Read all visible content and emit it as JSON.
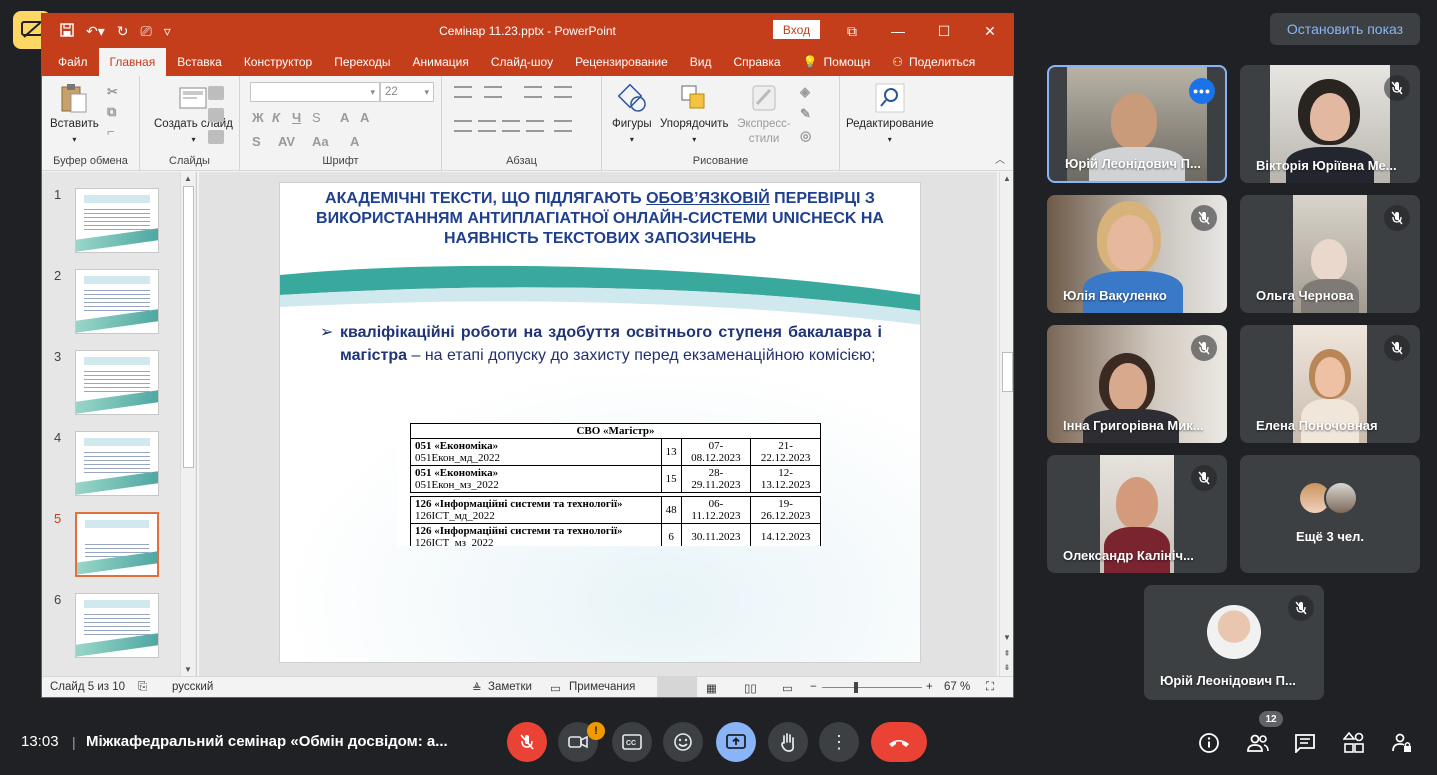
{
  "meet": {
    "stop_presenting_label": "Остановить показ",
    "time": "13:03",
    "meeting_title": "Міжкафедральний семінар «Обмін досвідом: а...",
    "participants_count": "12",
    "others_label": "Ещё 3 чел."
  },
  "ppt": {
    "title": "Семінар 11.23.pptx  -  PowerPoint",
    "login_label": "Вход",
    "tabs": [
      "Файл",
      "Главная",
      "Вставка",
      "Конструктор",
      "Переходы",
      "Анимация",
      "Слайд-шоу",
      "Рецензирование",
      "Вид",
      "Справка",
      "Помощн",
      "Поделиться"
    ],
    "ribbon": {
      "paste": "Вставить",
      "new_slide": "Создать слайд",
      "clipboard_group": "Буфер обмена",
      "slides_group": "Слайды",
      "font_group": "Шрифт",
      "paragraph_group": "Абзац",
      "drawing_group": "Рисование",
      "shapes": "Фигуры",
      "arrange": "Упорядочить",
      "quick_styles": "Экспресс-стили",
      "editing": "Редактирование",
      "font_size": "22"
    },
    "thumbnail_numbers": [
      "1",
      "2",
      "3",
      "4",
      "5",
      "6"
    ],
    "status": {
      "slide_of": "Слайд 5 из 10",
      "language": "русский",
      "notes": "Заметки",
      "comments": "Примечания",
      "zoom": "67 %"
    }
  },
  "slide": {
    "title_part1": "АКАДЕМІЧНІ ТЕКСТИ, ЩО ПІДЛЯГАЮТЬ ",
    "title_underlined": "ОБОВ’ЯЗКОВІЙ",
    "title_part2": " ПЕРЕВІРЦІ  З ВИКОРИСТАННЯМ АНТИПЛАГІАТНОЇ ОНЛАЙН-СИСТЕМИ UNICHECK НА НАЯВНІСТЬ ТЕКСТОВИХ ЗАПОЗИЧЕНЬ",
    "bullet_bold": "кваліфікаційні роботи на здобуття освітнього ступеня бакалавра і магістра",
    "bullet_rest": " –  на етапі допуску до захисту перед екзаменаційною комісією;",
    "table": {
      "header": "СВО «Магістр»",
      "rows": [
        {
          "program": "051 «Економіка»",
          "group": "051Екон_мд_2022",
          "count": "13",
          "dates1": "07-08.12.2023",
          "dates2": "21-22.12.2023"
        },
        {
          "program": "051 «Економіка»",
          "group": "051Екон_мз_2022",
          "count": "15",
          "dates1": "28-29.11.2023",
          "dates2": "12-13.12.2023"
        },
        {
          "program": "126 «Інформаційні системи та технології»",
          "group": "126ІСТ_мд_2022",
          "count": "48",
          "dates1": "06-11.12.2023",
          "dates2": "19-26.12.2023"
        },
        {
          "program": "126 «Інформаційні системи та технології»",
          "group": "126ІСТ_мз_2022",
          "count": "6",
          "dates1": "30.11.2023",
          "dates2": "14.12.2023"
        }
      ]
    }
  },
  "participants": [
    {
      "name": "Юрій Леонідович П..."
    },
    {
      "name": "Вікторія Юріївна Ме..."
    },
    {
      "name": "Юлія Вакуленко"
    },
    {
      "name": "Ольга Чернова"
    },
    {
      "name": "Інна Григорівна Мик..."
    },
    {
      "name": "Елена Поночовная"
    },
    {
      "name": "Олександр Калініч..."
    },
    {
      "name": "Юрій Леонідович П..."
    }
  ]
}
